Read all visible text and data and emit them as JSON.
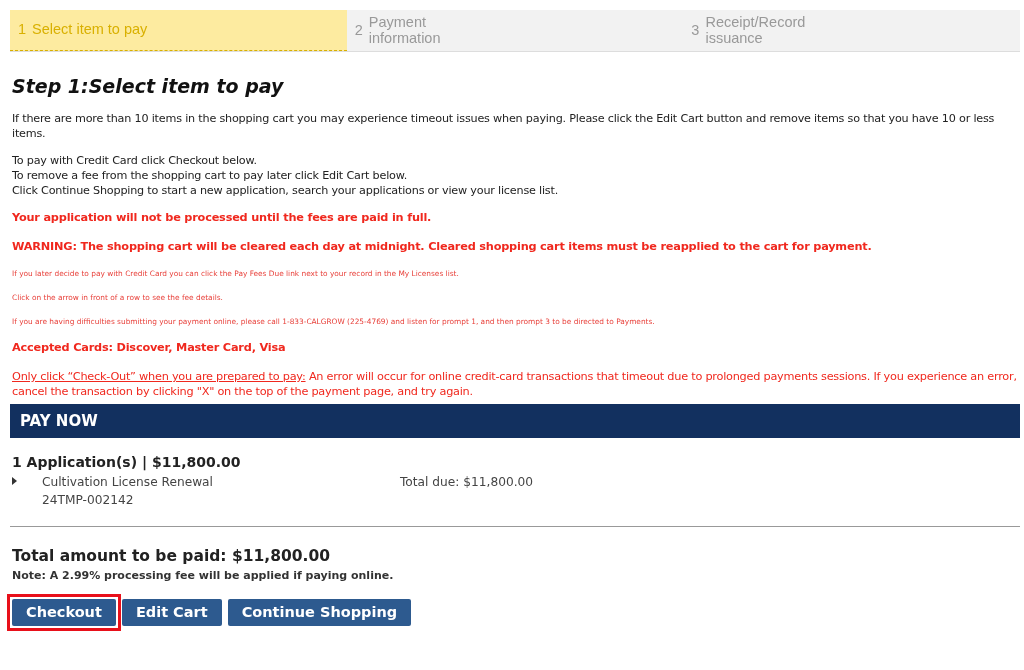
{
  "steps": [
    {
      "number": "1",
      "label": "Select item to pay",
      "selected": true
    },
    {
      "number": "2",
      "label": "Payment information",
      "selected": false
    },
    {
      "number": "3",
      "label": "Receipt/Record issuance",
      "selected": false
    }
  ],
  "title": "Step 1:Select item to pay",
  "intro": [
    {
      "lines": [
        "If there are more than 10 items in the shopping cart you may experience timeout issues when paying.  Please click the Edit Cart button and remove items so that you have 10 or less items."
      ]
    },
    {
      "lines": [
        "To pay with Credit Card click Checkout below.",
        "To remove a fee from the shopping cart to pay later click Edit Cart below.",
        "Click Continue Shopping to start a new application, search your applications or view your license list."
      ]
    }
  ],
  "notices": [
    {
      "kind": "warning",
      "text": "Your application will not be processed until the fees are paid in full."
    },
    {
      "kind": "warning",
      "text": "WARNING: The shopping cart will be cleared each day at midnight.  Cleared shopping cart items must be reapplied to the cart for payment."
    },
    {
      "kind": "fine",
      "text": "If you later decide to pay with Credit Card you can click the Pay Fees Due link next to your record in the My Licenses list."
    },
    {
      "kind": "fine",
      "text": "Click on the arrow in front of a row to see the fee details."
    },
    {
      "kind": "fine",
      "text": "If you are having difficulties submitting your payment online, please call 1-833-CALGROW (225-4769) and listen for prompt 1, and then prompt 3 to be directed to Payments."
    },
    {
      "kind": "warning",
      "text": "Accepted Cards:  Discover, Master Card, Visa"
    },
    {
      "kind": "caution",
      "lead": "Only click “Check-Out” when you are prepared to pay:",
      "text": "An error will occur for online credit-card transactions that timeout due to prolonged payments sessions. If you experience an error, cancel the transaction by clicking \"X\" on the top of the payment page, and try again."
    }
  ],
  "pay_now": {
    "header": "PAY NOW",
    "group_title": "1 Application(s) | $11,800.00",
    "items": [
      {
        "expanded": false,
        "name": "Cultivation License Renewal",
        "record": "24TMP-002142",
        "total": "Total due: $11,800.00"
      }
    ]
  },
  "total": "Total amount to be paid: $11,800.00",
  "note": "Note: A 2.99% processing fee will be applied if paying online.",
  "buttons": [
    {
      "label": "Checkout",
      "highlighted": true
    },
    {
      "label": "Edit Cart",
      "highlighted": false
    },
    {
      "label": "Continue Shopping",
      "highlighted": false
    }
  ]
}
